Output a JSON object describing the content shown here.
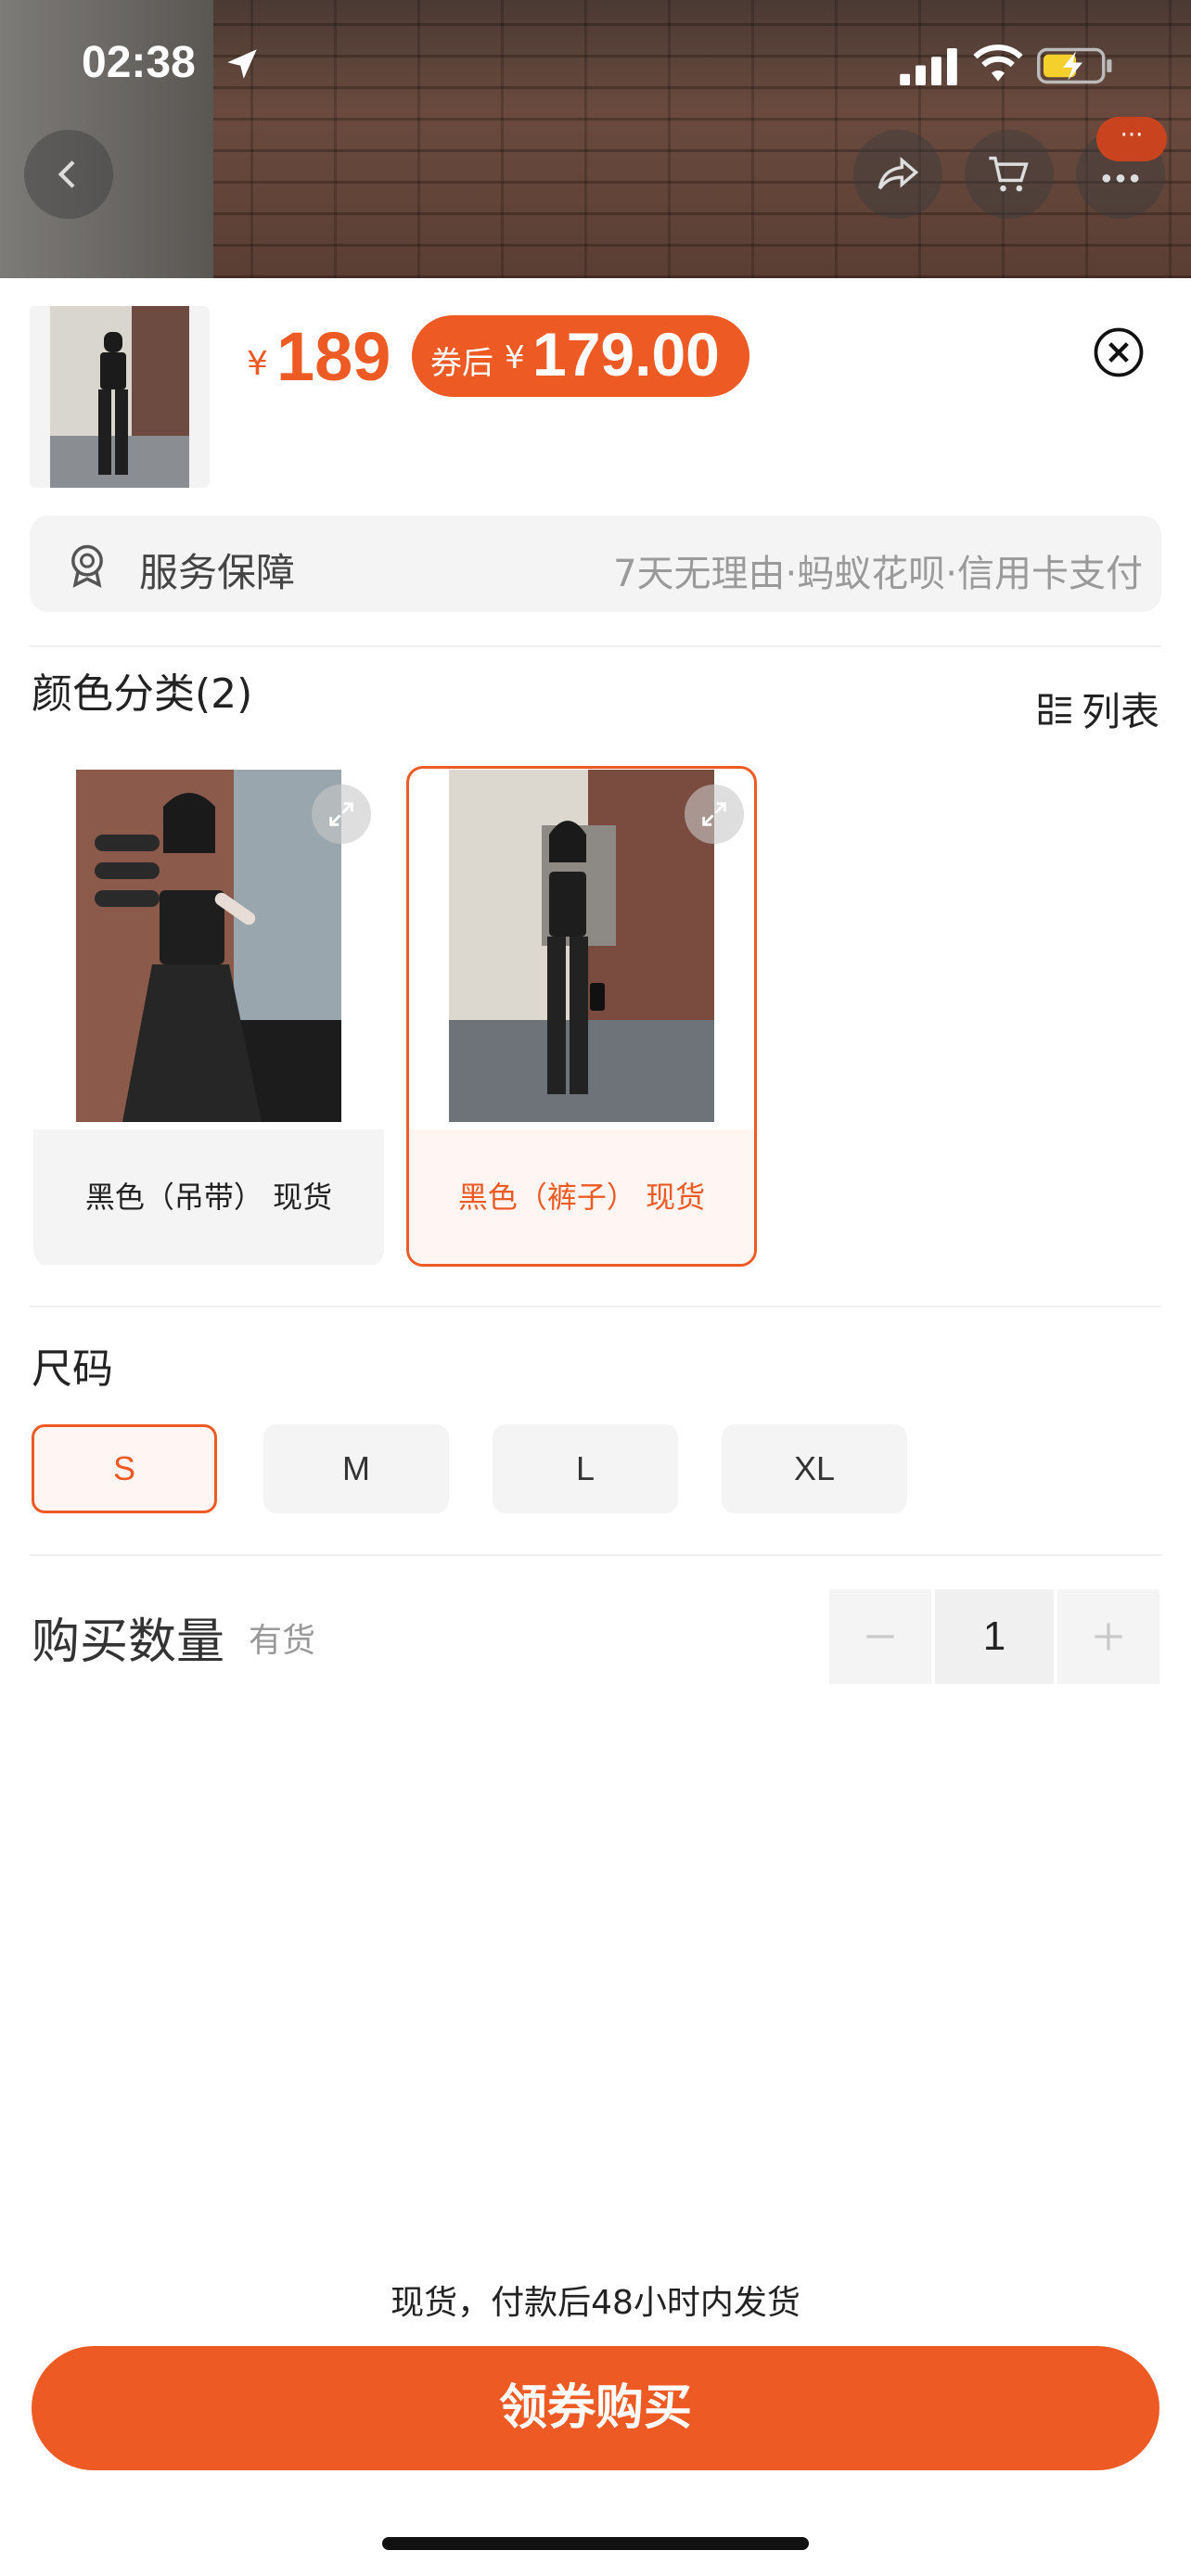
{
  "status_bar": {
    "time": "02:38"
  },
  "product": {
    "price_symbol": "¥",
    "price": "189",
    "coupon_label": "券后",
    "coupon_symbol": "¥",
    "coupon_price": "179.00"
  },
  "service": {
    "title": "服务保障",
    "detail": "7天无理由·蚂蚁花呗·信用卡支付"
  },
  "color_section": {
    "title": "颜色分类(2)",
    "list_toggle_label": "列表",
    "options": [
      {
        "label": "黑色（吊带） 现货",
        "selected": false
      },
      {
        "label": "黑色（裤子） 现货",
        "selected": true
      }
    ]
  },
  "size_section": {
    "title": "尺码",
    "options": [
      "S",
      "M",
      "L",
      "XL"
    ],
    "selected": "S"
  },
  "quantity": {
    "title": "购买数量",
    "stock": "有货",
    "value": "1"
  },
  "footer": {
    "ship_note": "现货，付款后48小时内发货",
    "buy_button": "领券购买"
  },
  "colors": {
    "accent": "#ee5a24",
    "selected_bg": "#fff5f2"
  },
  "icons": [
    "location-arrow-icon",
    "signal-icon",
    "wifi-icon",
    "battery-icon",
    "back-icon",
    "share-icon",
    "cart-icon",
    "more-icon",
    "close-icon",
    "service-badge-icon",
    "list-grid-icon",
    "expand-icon",
    "minus-icon",
    "plus-icon"
  ]
}
